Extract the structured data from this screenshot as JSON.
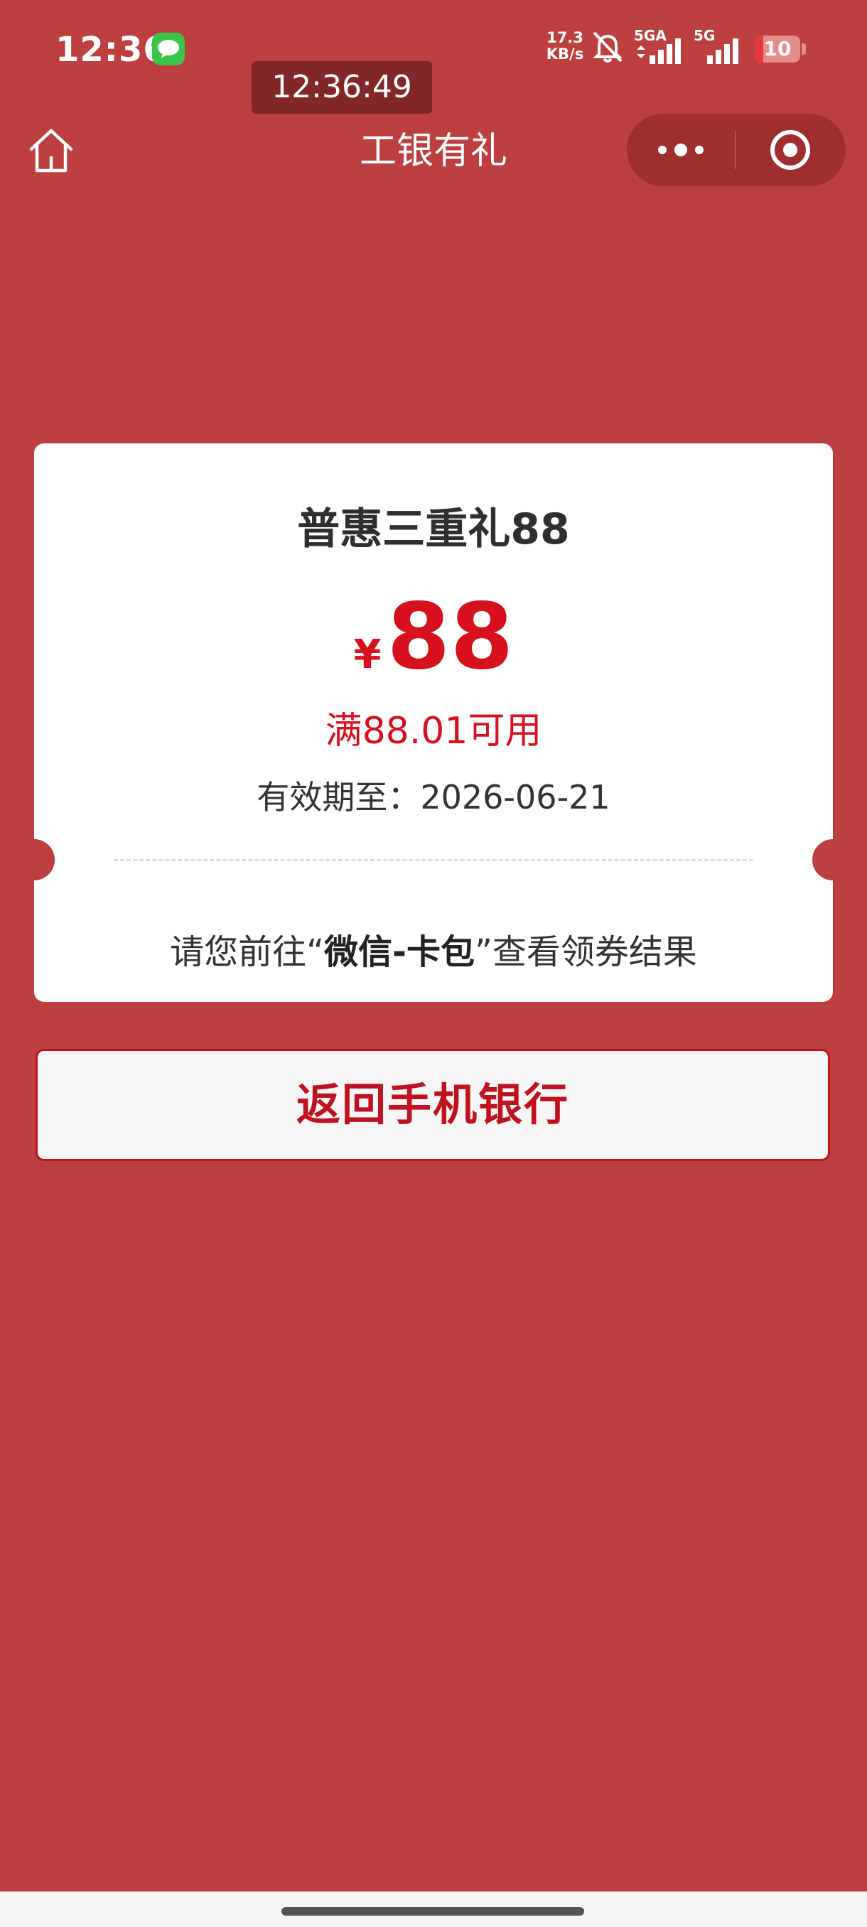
{
  "status_bar": {
    "time": "12:36",
    "net_speed_value": "17.3",
    "net_speed_unit": "KB/s",
    "signal1_label": "5GA",
    "signal2_label": "5G",
    "battery": "10",
    "icons": [
      "wechat-notification-icon",
      "mute-icon",
      "signal-icon",
      "signal-icon",
      "battery-icon"
    ]
  },
  "time_overlay": "12:36:49",
  "nav": {
    "title": "工银有礼",
    "icons": [
      "home-icon",
      "more-icon",
      "close-target-icon"
    ]
  },
  "coupon": {
    "title": "普惠三重礼88",
    "currency": "¥",
    "amount": "88",
    "threshold": "满88.01可用",
    "valid_label": "有效期至：",
    "valid_date": "2026-06-21",
    "notice_prefix": "请您前往“",
    "notice_highlight": "微信-卡包",
    "notice_suffix": "”查看领券结果"
  },
  "actions": {
    "return_label": "返回手机银行"
  },
  "colors": {
    "background": "#bd3f3f",
    "accent_red": "#d6101c",
    "button_border": "#c0121e"
  }
}
